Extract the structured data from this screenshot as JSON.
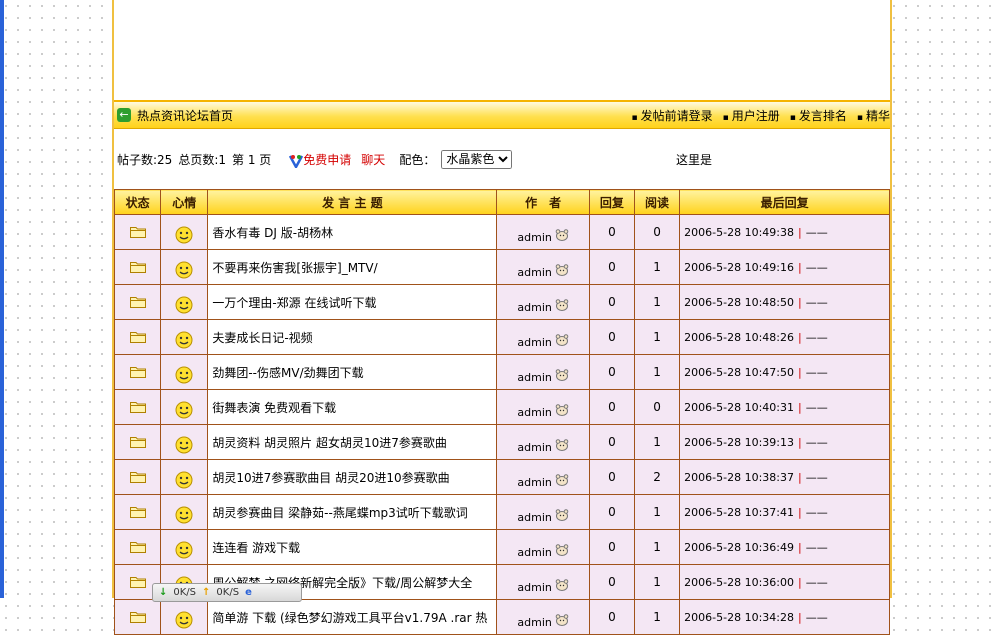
{
  "nav": {
    "home_label": "热点资讯论坛首页",
    "links": [
      "发帖前请登录",
      "用户注册",
      "发言排名",
      "精华"
    ]
  },
  "info": {
    "post_count": "帖子数:25",
    "page_count": "总页数:1",
    "current_page": "第 1 页",
    "apply_label": "免费申请",
    "chat_label": "聊天",
    "color_label": "配色：",
    "theme_selected": "水晶紫色",
    "marquee_text": "这里是"
  },
  "table": {
    "headers": [
      "状态",
      "心情",
      "发 言 主 题",
      "作　者",
      "回复",
      "阅读",
      "最后回复"
    ],
    "rows": [
      {
        "subject": "香水有毒 DJ 版-胡杨林",
        "author": "admin",
        "replies": "0",
        "reads": "0",
        "last": "2006-5-28 10:49:38",
        "last_by": "——"
      },
      {
        "subject": "不要再来伤害我[张振宇]_MTV/",
        "author": "admin",
        "replies": "0",
        "reads": "1",
        "last": "2006-5-28 10:49:16",
        "last_by": "——"
      },
      {
        "subject": "一万个理由-郑源 在线试听下载",
        "author": "admin",
        "replies": "0",
        "reads": "1",
        "last": "2006-5-28 10:48:50",
        "last_by": "——"
      },
      {
        "subject": "夫妻成长日记-视频",
        "author": "admin",
        "replies": "0",
        "reads": "1",
        "last": "2006-5-28 10:48:26",
        "last_by": "——"
      },
      {
        "subject": "劲舞团--伤感MV/劲舞团下载",
        "author": "admin",
        "replies": "0",
        "reads": "1",
        "last": "2006-5-28 10:47:50",
        "last_by": "——"
      },
      {
        "subject": "街舞表演 免费观看下载",
        "author": "admin",
        "replies": "0",
        "reads": "0",
        "last": "2006-5-28 10:40:31",
        "last_by": "——"
      },
      {
        "subject": "胡灵资料 胡灵照片 超女胡灵10进7参赛歌曲",
        "author": "admin",
        "replies": "0",
        "reads": "1",
        "last": "2006-5-28 10:39:13",
        "last_by": "——"
      },
      {
        "subject": "胡灵10进7参赛歌曲目 胡灵20进10参赛歌曲",
        "author": "admin",
        "replies": "0",
        "reads": "2",
        "last": "2006-5-28 10:38:37",
        "last_by": "——"
      },
      {
        "subject": "胡灵参赛曲目 梁静茹--燕尾蝶mp3试听下载歌词",
        "author": "admin",
        "replies": "0",
        "reads": "1",
        "last": "2006-5-28 10:37:41",
        "last_by": "——"
      },
      {
        "subject": "连连看 游戏下载",
        "author": "admin",
        "replies": "0",
        "reads": "1",
        "last": "2006-5-28 10:36:49",
        "last_by": "——"
      },
      {
        "subject": "周公解梦 之网络新解完全版》下载/周公解梦大全",
        "author": "admin",
        "replies": "0",
        "reads": "1",
        "last": "2006-5-28 10:36:00",
        "last_by": "——"
      },
      {
        "subject": "简单游 下载 (绿色梦幻游戏工具平台v1.79A .rar 热",
        "author": "admin",
        "replies": "0",
        "reads": "1",
        "last": "2006-5-28 10:34:28",
        "last_by": "——"
      }
    ]
  },
  "toolbar": {
    "down_rate": "0K/S",
    "up_rate": "0K/S"
  }
}
